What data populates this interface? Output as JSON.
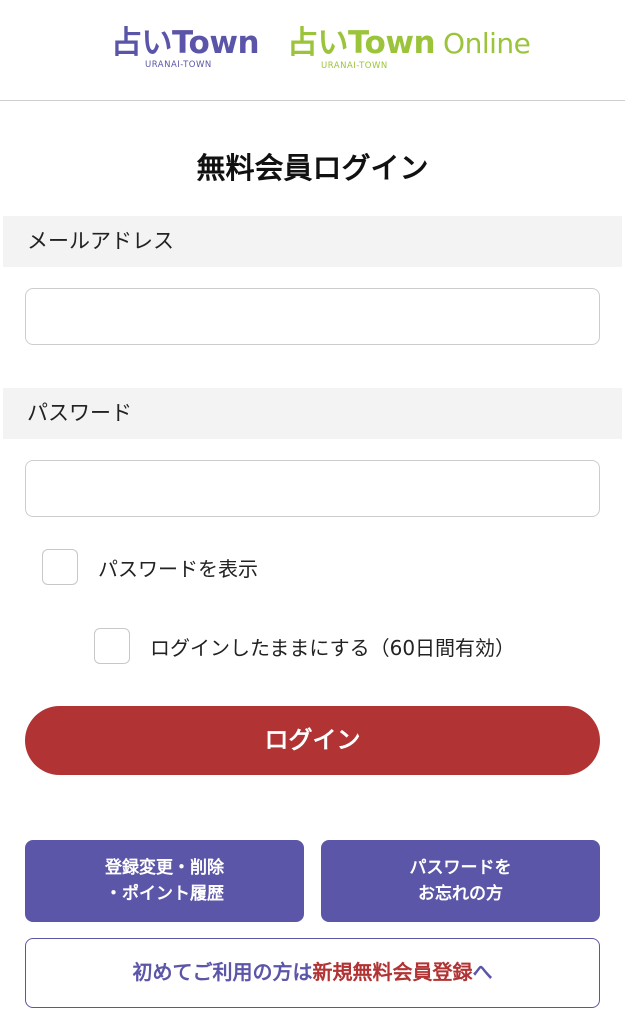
{
  "header": {
    "logo_primary": {
      "main": "占いTown",
      "sub": "URANAI-TOWN"
    },
    "logo_online": {
      "main": "占いTown",
      "suffix": "Online",
      "sub": "URANAI-TOWN"
    }
  },
  "page_title": "無料会員ログイン",
  "email": {
    "label": "メールアドレス",
    "value": ""
  },
  "password": {
    "label": "パスワード",
    "value": ""
  },
  "show_password": {
    "label": "パスワードを表示",
    "checked": false
  },
  "keep_login": {
    "label": "ログインしたままにする（60日間有効）",
    "checked": false
  },
  "login_button": "ログイン",
  "edit_button": {
    "line1": "登録変更・削除",
    "line2": "・ポイント履歴"
  },
  "forgot_button": {
    "line1": "パスワードを",
    "line2": "お忘れの方"
  },
  "register": {
    "prefix": "初めてご利用の方は",
    "emphasis": "新規無料会員登録",
    "suffix": "へ"
  },
  "colors": {
    "primary_purple": "#5c56a8",
    "accent_red": "#b23333",
    "online_green": "#9cc43a",
    "label_band_bg": "#f3f3f3"
  }
}
